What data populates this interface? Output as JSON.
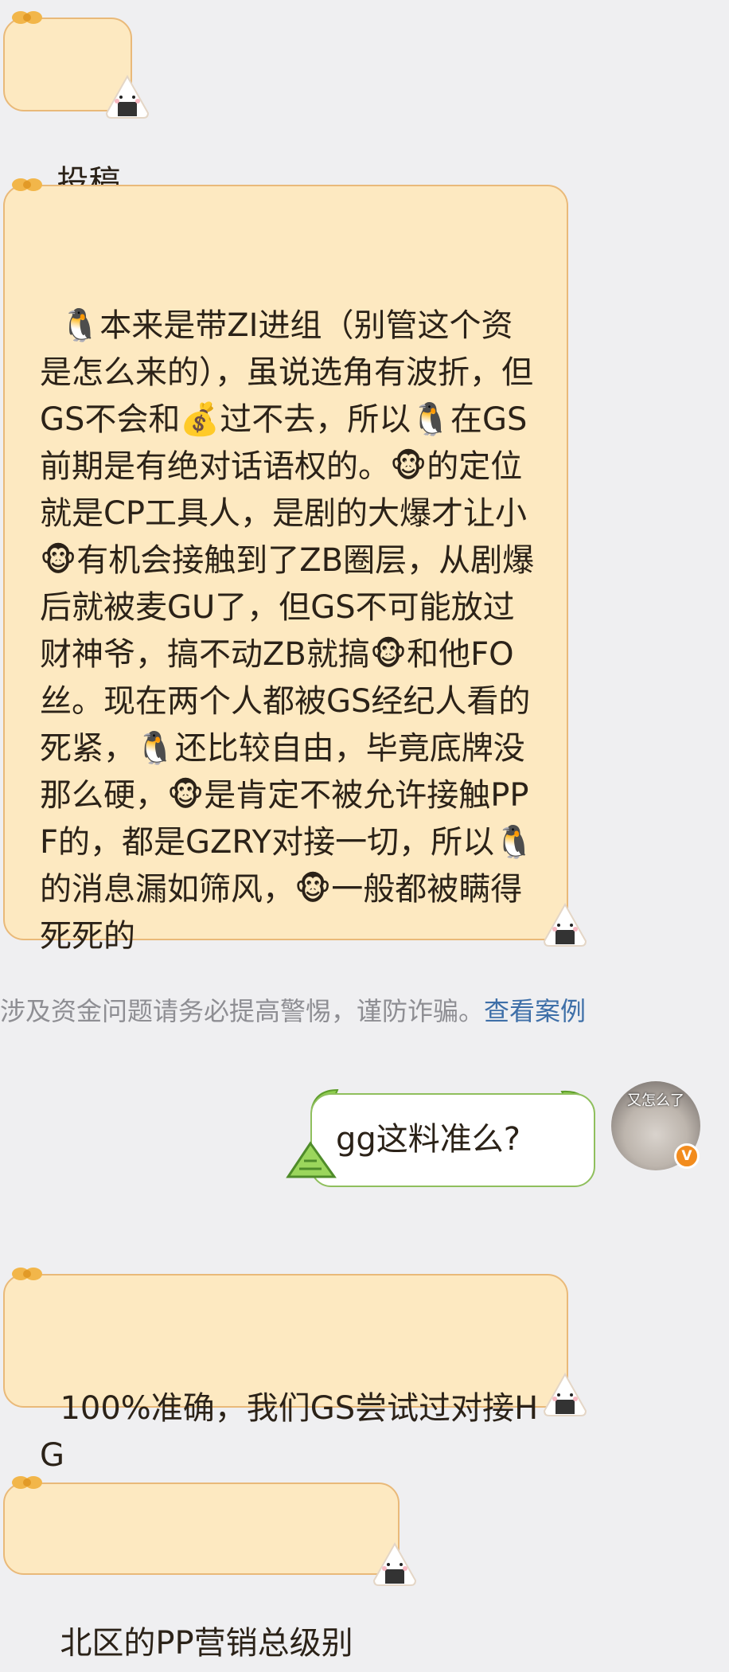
{
  "messages": [
    {
      "text": "投稿"
    },
    {
      "text": "🐧本来是带ZI进组（别管这个资是怎么来的），虽说选角有波折，但GS不会和💰过不去，所以🐧在GS前期是有绝对话语权的。🐵的定位就是CP工具人，是剧的大爆才让小🐵有机会接触到了ZB圈层，从剧爆后就被麦GU了，但GS不可能放过财神爷，搞不动ZB就搞🐵和他FO丝。现在两个人都被GS经纪人看的死紧，🐧还比较自由，毕竟底牌没那么硬，🐵是肯定不被允许接触PPF的，都是GZRY对接一切，所以🐧的消息漏如筛风，🐵一般都被瞒得死死的"
    },
    {
      "text": "100%准确，我们GS尝试过对接HG"
    },
    {
      "text": "北区的PP营销总级别"
    }
  ],
  "notice": {
    "text": "涉及资金问题请务必提高警惕，谨防诈骗。",
    "link": "查看案例"
  },
  "sent_message": {
    "text": "gg这料准么?"
  },
  "avatar": {
    "caption": "又怎么了",
    "badge": "V"
  },
  "colors": {
    "background": "#efeff1",
    "received_bubble": "#fde9c1",
    "received_border": "#e9b979",
    "sent_bubble": "#ffffff",
    "sent_border": "#8fbf5d",
    "link": "#3e6fa8",
    "badge": "#f28c1e"
  }
}
